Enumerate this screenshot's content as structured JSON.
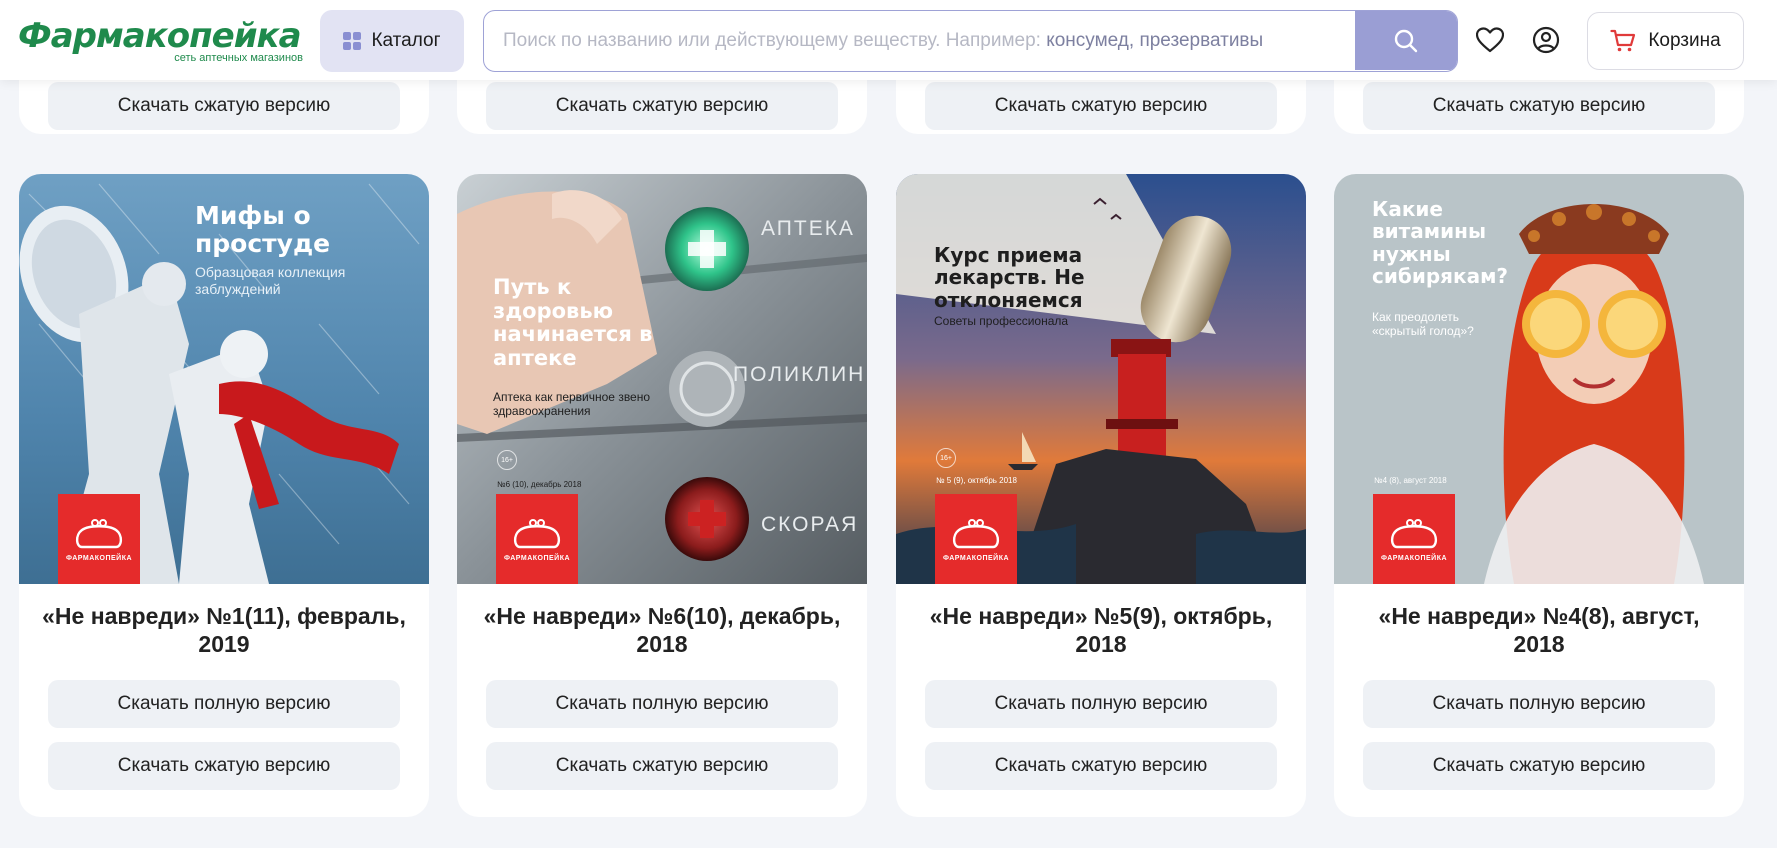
{
  "header": {
    "logo_text": "Фармакопейка",
    "logo_subtitle": "сеть аптечных магазинов",
    "catalog_label": "Каталог",
    "search_placeholder": "Поиск по названию или действующему веществу. Например:",
    "search_examples": "консумед, презервативы",
    "cart_label": "Корзина",
    "icons": [
      "grid-icon",
      "search-icon",
      "heart-icon",
      "user-icon",
      "cart-icon"
    ],
    "accent_color": "#1f8a4c",
    "search_button_color": "#9a9ed4"
  },
  "top_row": {
    "cards": [
      {
        "compressed_label": "Скачать сжатую версию"
      },
      {
        "compressed_label": "Скачать сжатую версию"
      },
      {
        "compressed_label": "Скачать сжатую версию"
      },
      {
        "compressed_label": "Скачать сжатую версию"
      }
    ]
  },
  "cards": [
    {
      "title": "«Не навреди» №1(11), февраль, 2019",
      "full_label": "Скачать полную версию",
      "compressed_label": "Скачать сжатую версию",
      "cover": {
        "headline": "Мифы о простуде",
        "subtitle": "Образцовая коллекция заблуждений",
        "brand": "ФАРМАКОПЕЙКА"
      }
    },
    {
      "title": "«Не навреди» №6(10), декабрь, 2018",
      "full_label": "Скачать полную версию",
      "compressed_label": "Скачать сжатую версию",
      "cover": {
        "headline": "Путь к здоровью начинается в аптеке",
        "subtitle": "Аптека как первичное звено здравоохранения",
        "issue": "№6 (10), декабрь 2018",
        "age": "16+",
        "labels": [
          "АПТЕКА",
          "ПОЛИКЛИН",
          "СКОРАЯ"
        ],
        "brand": "ФАРМАКОПЕЙКА"
      }
    },
    {
      "title": "«Не навреди» №5(9), октябрь, 2018",
      "full_label": "Скачать полную версию",
      "compressed_label": "Скачать сжатую версию",
      "cover": {
        "headline": "Курс приема лекарств. Не отклоняемся",
        "subtitle": "Советы профессионала",
        "issue": "№ 5 (9), октябрь 2018",
        "age": "16+",
        "brand": "ФАРМАКОПЕЙКА"
      }
    },
    {
      "title": "«Не навреди» №4(8), август, 2018",
      "full_label": "Скачать полную версию",
      "compressed_label": "Скачать сжатую версию",
      "cover": {
        "headline": "Какие витамины нужны сибирякам?",
        "subtitle": "Как преодолеть «скрытый голод»?",
        "issue": "№4 (8), август 2018",
        "brand": "ФАРМАКОПЕЙКА"
      }
    }
  ]
}
